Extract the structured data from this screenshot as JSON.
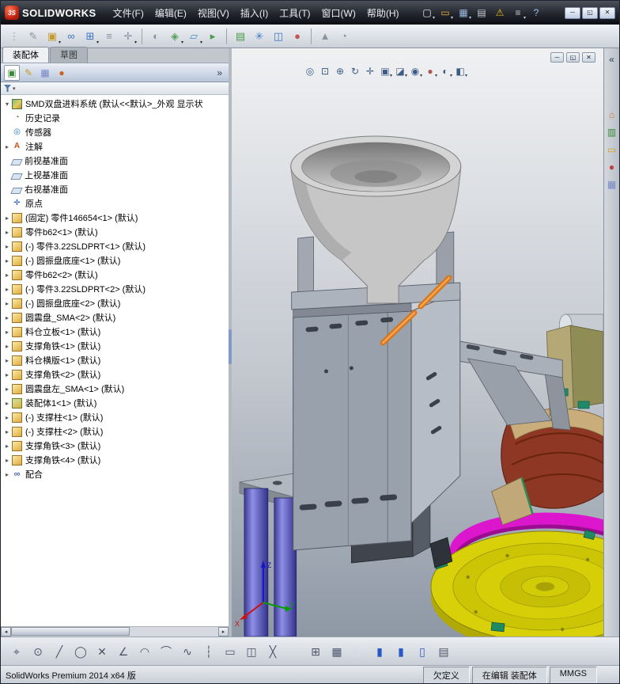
{
  "titlebar": {
    "logo_mark": "3S",
    "logo": "SOLIDWORKS",
    "menus": [
      "文件(F)",
      "编辑(E)",
      "视图(V)",
      "插入(I)",
      "工具(T)",
      "窗口(W)",
      "帮助(H)"
    ],
    "quick_icons": [
      {
        "n": "new-document",
        "g": "▢",
        "c": "#e8ecf4",
        "dd": 1
      },
      {
        "n": "open-document",
        "g": "▭",
        "c": "#e8b83a",
        "dd": 1
      },
      {
        "n": "save",
        "g": "▦",
        "c": "#9ab8e0",
        "dd": 1
      },
      {
        "n": "print",
        "g": "▤",
        "c": "#c8ccd4"
      },
      {
        "n": "rebuild-warning",
        "g": "⚠",
        "c": "#e8c020"
      },
      {
        "n": "options",
        "g": "≡",
        "c": "#c8ccd4",
        "dd": 1
      },
      {
        "n": "help",
        "g": "?",
        "c": "#9ac0f0"
      }
    ],
    "window_buttons": [
      {
        "n": "window-minimize",
        "g": "─",
        "cls": "win-btn"
      },
      {
        "n": "window-maximize",
        "g": "◱",
        "cls": "win-btn"
      },
      {
        "n": "window-close",
        "g": "✕",
        "cls": "win-btn"
      }
    ]
  },
  "toolbar_main": [
    {
      "n": "toolbar-grip",
      "g": "⋮",
      "c": "#9aa4b0"
    },
    {
      "n": "edit-component",
      "g": "✎",
      "c": "#8a929e"
    },
    {
      "n": "insert-components",
      "g": "▣",
      "c": "#c89a28",
      "dd": 1
    },
    {
      "n": "mate",
      "g": "∞",
      "c": "#3a78c0"
    },
    {
      "n": "linear-component-pattern",
      "g": "⊞",
      "c": "#3a78c0",
      "dd": 1
    },
    {
      "n": "smart-fasteners",
      "g": "≡",
      "c": "#8a929e"
    },
    {
      "n": "move-component",
      "g": "✛",
      "c": "#8a929e",
      "dd": 1
    },
    "|",
    {
      "n": "show-hidden-components",
      "g": "◐",
      "c": "#8a929e"
    },
    {
      "n": "assembly-features",
      "g": "◈",
      "c": "#58a058",
      "dd": 1
    },
    {
      "n": "reference-geometry",
      "g": "▱",
      "c": "#4a88c8",
      "dd": 1
    },
    {
      "n": "new-motion-study",
      "g": "▸",
      "c": "#4a9a4a"
    },
    "|",
    {
      "n": "bill-of-materials",
      "g": "▤",
      "c": "#4a9a4a"
    },
    {
      "n": "exploded-view",
      "g": "✳",
      "c": "#3a78c0"
    },
    {
      "n": "interference-detection",
      "g": "◫",
      "c": "#3a78c0"
    },
    {
      "n": "edit-appearance",
      "g": "●",
      "c": "#c05858"
    },
    "|",
    {
      "n": "simulationxpress",
      "g": "▲",
      "c": "#8a929e"
    },
    {
      "n": "photoview-preview",
      "g": "◔",
      "c": "#8a929e"
    }
  ],
  "view_toolbar": [
    {
      "n": "zoom-to-fit",
      "g": "◎"
    },
    {
      "n": "zoom-to-area",
      "g": "⊡"
    },
    {
      "n": "zoom-in-out",
      "g": "⊕"
    },
    {
      "n": "rotate-view",
      "g": "↻"
    },
    {
      "n": "pan",
      "g": "✛"
    },
    {
      "n": "view-orientation",
      "g": "▣",
      "dd": 1
    },
    {
      "n": "display-style",
      "g": "◪",
      "dd": 1
    },
    {
      "n": "hide-show-items",
      "g": "◉",
      "dd": 1
    },
    {
      "n": "edit-appearance",
      "g": "●",
      "c": "#b05858",
      "dd": 1
    },
    {
      "n": "apply-scene",
      "g": "◐",
      "dd": 1
    },
    {
      "n": "view-settings",
      "g": "◧",
      "dd": 1
    }
  ],
  "doc_controls": [
    {
      "n": "document-minimize",
      "g": "─",
      "cls": "doc-btn"
    },
    {
      "n": "document-restore",
      "g": "◱",
      "cls": "doc-btn"
    },
    {
      "n": "document-close",
      "g": "✕",
      "cls": "doc-btn"
    }
  ],
  "taskpane": [
    {
      "n": "taskpane-collapse",
      "g": "«",
      "cls": "tp-top"
    },
    {
      "n": "solidworks-resources",
      "g": "⌂",
      "c": "#d07020"
    },
    {
      "n": "design-library",
      "g": "▥",
      "c": "#3a8a3a"
    },
    {
      "n": "file-explorer",
      "g": "▭",
      "c": "#d8a020"
    },
    {
      "n": "appearances-scenes",
      "g": "●",
      "c": "#c04040"
    },
    {
      "n": "custom-properties",
      "g": "▦",
      "c": "#7888c8"
    }
  ],
  "panel": {
    "tab_assembly": "装配体",
    "tab_sketch": "草图",
    "manager_tabs": [
      {
        "n": "featuremanager-design-tree",
        "g": "▣",
        "c": "#3a8a3a"
      },
      {
        "n": "propertymanager",
        "g": "✎",
        "c": "#c89a28"
      },
      {
        "n": "configurationmanager",
        "g": "▦",
        "c": "#7888c8"
      },
      {
        "n": "displaymanager",
        "g": "●",
        "c": "#d06020"
      }
    ],
    "expand_label": "»"
  },
  "tree": {
    "root_label": "SMD双盘进料系统 (默认<<默认>_外观 显示状",
    "items": [
      {
        "t": "history",
        "label": "历史记录"
      },
      {
        "t": "sensor",
        "label": "传感器"
      },
      {
        "t": "annotation",
        "a": 1,
        "label": "注解"
      },
      {
        "t": "plane",
        "label": "前视基准面"
      },
      {
        "t": "plane",
        "label": "上视基准面"
      },
      {
        "t": "plane",
        "label": "右视基准面"
      },
      {
        "t": "origin",
        "label": "原点"
      },
      {
        "t": "part",
        "a": 1,
        "label": "(固定) 零件146654<1> (默认)"
      },
      {
        "t": "part",
        "a": 1,
        "label": "零件b62<1> (默认)"
      },
      {
        "t": "part",
        "a": 1,
        "label": "(-) 零件3.22SLDPRT<1> (默认)"
      },
      {
        "t": "part",
        "a": 1,
        "label": "(-) 圆振盘底座<1> (默认)"
      },
      {
        "t": "part",
        "a": 1,
        "label": "零件b62<2> (默认)"
      },
      {
        "t": "part",
        "a": 1,
        "label": "(-) 零件3.22SLDPRT<2> (默认)"
      },
      {
        "t": "part",
        "a": 1,
        "label": "(-) 圆振盘底座<2> (默认)"
      },
      {
        "t": "part",
        "a": 1,
        "label": "圆震盘_SMA<2> (默认)"
      },
      {
        "t": "part",
        "a": 1,
        "label": "料仓立板<1> (默认)"
      },
      {
        "t": "part",
        "a": 1,
        "label": "支撑角铁<1> (默认)"
      },
      {
        "t": "part",
        "a": 1,
        "label": "料仓横版<1> (默认)"
      },
      {
        "t": "part",
        "a": 1,
        "label": "支撑角铁<2> (默认)"
      },
      {
        "t": "part",
        "a": 1,
        "label": "圆震盘左_SMA<1> (默认)"
      },
      {
        "t": "subassembly",
        "a": 1,
        "label": "装配体1<1> (默认)"
      },
      {
        "t": "part",
        "a": 1,
        "label": "(-) 支撑柱<1> (默认)"
      },
      {
        "t": "part",
        "a": 1,
        "label": "(-) 支撑柱<2> (默认)"
      },
      {
        "t": "part",
        "a": 1,
        "label": "支撑角铁<3> (默认)"
      },
      {
        "t": "part",
        "a": 1,
        "label": "支撑角铁<4> (默认)"
      },
      {
        "t": "mates",
        "a": 1,
        "label": "配合"
      }
    ]
  },
  "toolbar_sketch_left": [
    {
      "n": "select",
      "g": "⌖"
    },
    {
      "n": "sketch-point",
      "g": "⊙"
    },
    {
      "n": "sketch-line",
      "g": "╱"
    },
    {
      "n": "sketch-circle",
      "g": "◯"
    },
    {
      "n": "sketch-erase",
      "g": "✕"
    },
    {
      "n": "sketch-angle",
      "g": "∠"
    },
    {
      "n": "sketch-arc",
      "g": "◠"
    },
    {
      "n": "sketch-tangent-arc",
      "g": "⌒"
    },
    {
      "n": "sketch-spline",
      "g": "∿"
    },
    {
      "n": "sketch-centerline",
      "g": "┆"
    },
    {
      "n": "sketch-rectangle",
      "g": "▭"
    },
    {
      "n": "sketch-mirror",
      "g": "◫"
    },
    {
      "n": "sketch-trim",
      "g": "╳"
    }
  ],
  "toolbar_sketch_right": [
    {
      "n": "quick-snaps",
      "g": "⊞"
    },
    {
      "n": "grid-settings",
      "g": "▦"
    },
    {
      "n": "plane-display",
      "g": "◣",
      "c": "#d8dce2"
    },
    {
      "n": "document-view-1",
      "g": "▮",
      "c": "#2858c8"
    },
    {
      "n": "document-view-2",
      "g": "▮",
      "c": "#2858c8"
    },
    {
      "n": "document-view-3",
      "g": "▯",
      "c": "#2858c8"
    },
    {
      "n": "design-table",
      "g": "▤"
    }
  ],
  "statusbar": {
    "left": "SolidWorks Premium 2014 x64 版",
    "cells": [
      "欠定义",
      "在编辑 装配体",
      "MMGS"
    ]
  },
  "viewport": {
    "triad": {
      "x": "X",
      "y": "Y",
      "z": "Z"
    }
  },
  "colors": {
    "selected_edge_orange": "#d9751c",
    "bowl_yellow": "#d8d008",
    "ring_magenta": "#dc16cc",
    "column_blue": "#5656c8",
    "frame_gray": "#99a1ad",
    "track_maroon": "#8d3724"
  }
}
